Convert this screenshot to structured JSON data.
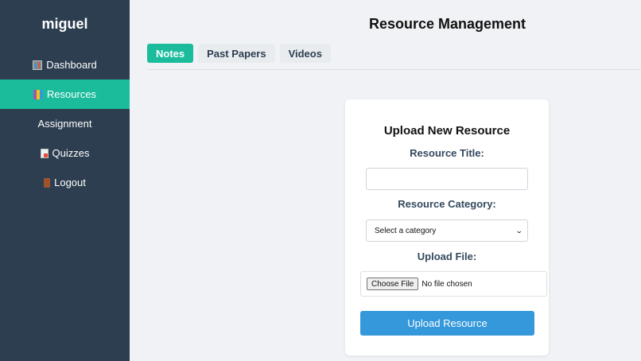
{
  "sidebar": {
    "brand": "miguel",
    "items": [
      {
        "label": "Dashboard",
        "icon": "dashboard-icon"
      },
      {
        "label": "Resources",
        "icon": "resources-icon",
        "active": true
      },
      {
        "label": "Assignment"
      },
      {
        "label": "Quizzes",
        "icon": "quizzes-icon"
      },
      {
        "label": "Logout",
        "icon": "logout-icon"
      }
    ]
  },
  "header": {
    "title": "Resource Management"
  },
  "tabs": [
    {
      "label": "Notes",
      "active": true
    },
    {
      "label": "Past Papers"
    },
    {
      "label": "Videos"
    }
  ],
  "form": {
    "title": "Upload New Resource",
    "resource_title_label": "Resource Title:",
    "resource_title_value": "",
    "category_label": "Resource Category:",
    "category_selected": "Select a category",
    "file_label": "Upload File:",
    "file_button": "Choose File",
    "file_status": "No file chosen",
    "submit_label": "Upload Resource"
  },
  "colors": {
    "sidebar_bg": "#2c3e50",
    "accent": "#1abc9c",
    "primary_button": "#3498db",
    "page_bg": "#f0f2f5"
  }
}
